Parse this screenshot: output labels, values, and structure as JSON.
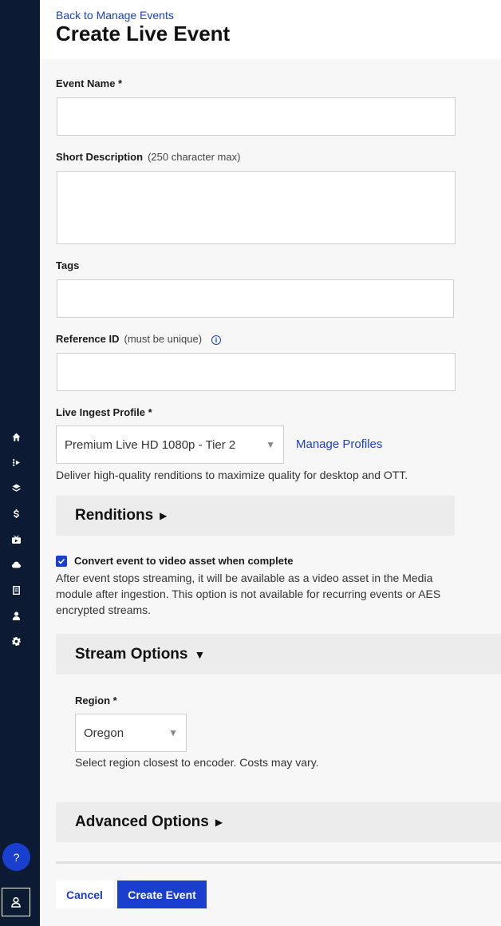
{
  "nav": {
    "items": [
      {
        "name": "home-icon"
      },
      {
        "name": "video-icon"
      },
      {
        "name": "layers-icon"
      },
      {
        "name": "dollar-icon"
      },
      {
        "name": "live-icon"
      },
      {
        "name": "cloud-icon"
      },
      {
        "name": "document-icon"
      },
      {
        "name": "person-icon"
      },
      {
        "name": "gear-icon"
      }
    ],
    "help_label": "?"
  },
  "header": {
    "back_link": "Back to Manage Events",
    "title": "Create Live Event"
  },
  "form": {
    "event_name": {
      "label": "Event Name *",
      "value": ""
    },
    "short_description": {
      "label": "Short Description",
      "hint": "(250 character max)",
      "value": ""
    },
    "tags": {
      "label": "Tags",
      "value": ""
    },
    "reference_id": {
      "label": "Reference ID",
      "hint": "(must be unique)",
      "info": "i",
      "value": ""
    },
    "ingest_profile": {
      "label": "Live Ingest Profile *",
      "value": "Premium Live HD 1080p - Tier 2",
      "manage_link": "Manage Profiles",
      "help": "Deliver high-quality renditions to maximize quality for desktop and OTT."
    },
    "renditions": {
      "title": "Renditions",
      "indicator": "▶"
    },
    "convert": {
      "checked": true,
      "label": "Convert event to video asset when complete",
      "help": "After event stops streaming, it will be available as a video asset in the Media module after ingestion. This option is not available for recurring events or AES encrypted streams."
    },
    "stream_options": {
      "title": "Stream Options",
      "indicator": "▼",
      "region_label": "Region *",
      "region_value": "Oregon",
      "region_help": "Select region closest to encoder. Costs may vary."
    },
    "advanced_options": {
      "title": "Advanced Options",
      "indicator": "▶"
    }
  },
  "actions": {
    "cancel": "Cancel",
    "create": "Create Event"
  },
  "colors": {
    "sidebar": "#0c1a33",
    "accent": "#1a3fcf"
  }
}
